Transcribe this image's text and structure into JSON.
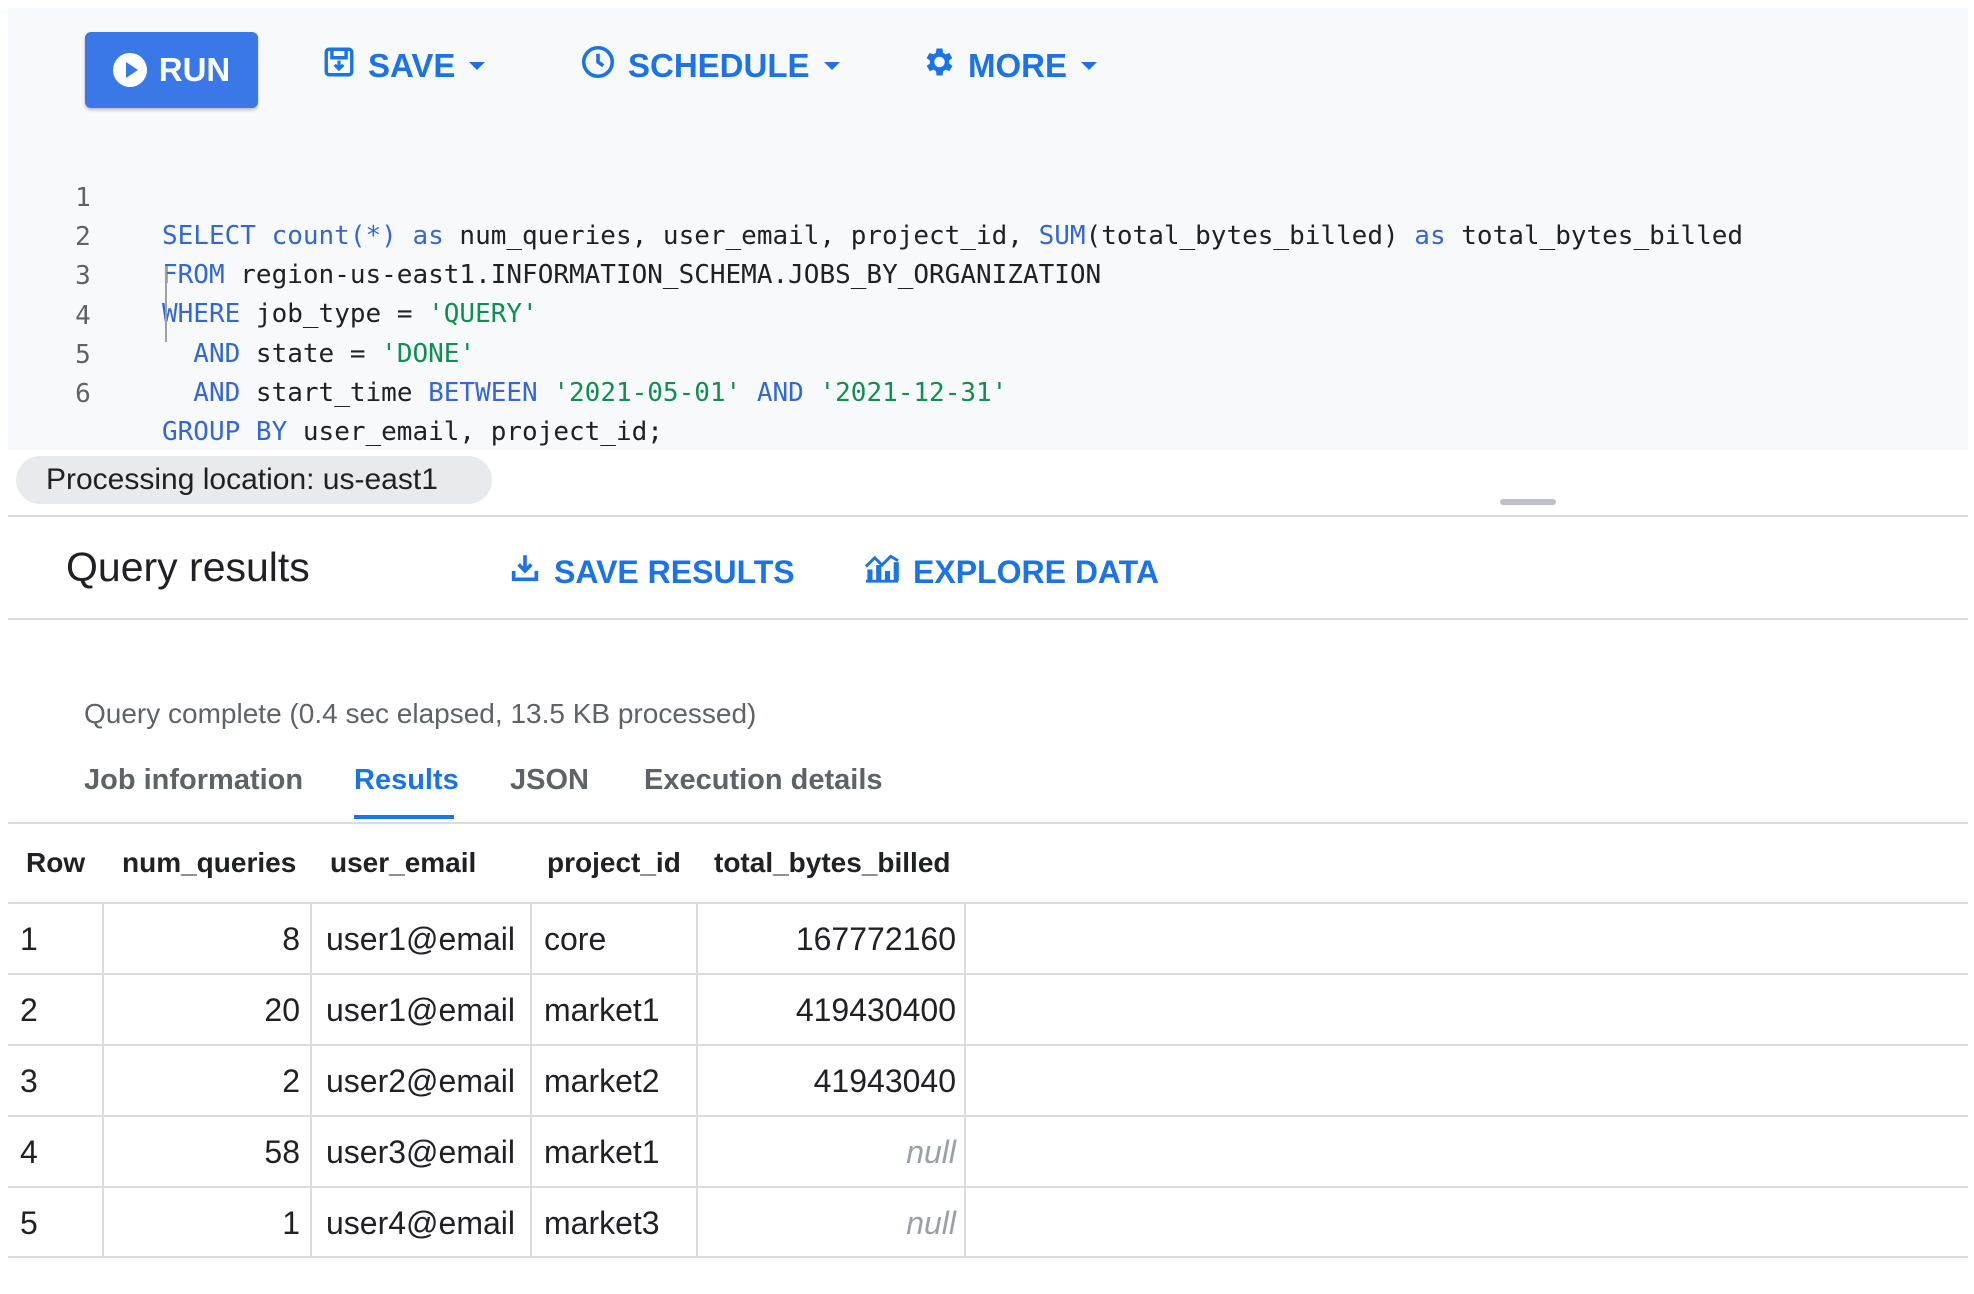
{
  "toolbar": {
    "run_label": "RUN",
    "save_label": "SAVE",
    "schedule_label": "SCHEDULE",
    "more_label": "MORE"
  },
  "editor": {
    "lines": [
      {
        "num": "1"
      },
      {
        "num": "2"
      },
      {
        "num": "3"
      },
      {
        "num": "4"
      },
      {
        "num": "5"
      },
      {
        "num": "6"
      }
    ],
    "tokens": {
      "l1_a": "SELECT count(*) as",
      "l1_b": " num_queries, user_email, project_id,",
      "l1_c": " SUM",
      "l1_d": "(total_bytes_billed)",
      "l1_e": " as",
      "l1_f": " total_bytes_billed",
      "l2_a": "FROM",
      "l2_b": " region-us-east1.INFORMATION_SCHEMA.JOBS_BY_ORGANIZATION",
      "l3_a": "WHERE",
      "l3_b": " job_type = ",
      "l3_c": "'QUERY'",
      "l4_a": "  AND",
      "l4_b": " state = ",
      "l4_c": "'DONE'",
      "l5_a": "  AND",
      "l5_b": " start_time ",
      "l5_c": "BETWEEN",
      "l5_d": " ",
      "l5_e": "'2021-05-01'",
      "l5_f": " AND",
      "l5_g": " ",
      "l5_h": "'2021-12-31'",
      "l6_a": "GROUP BY",
      "l6_b": " user_email, project_id;"
    }
  },
  "processing_location": "Processing location: us-east1",
  "results": {
    "title": "Query results",
    "save_results_label": "SAVE RESULTS",
    "explore_data_label": "EXPLORE DATA",
    "status": "Query complete (0.4 sec elapsed, 13.5 KB processed)",
    "tabs": [
      "Job information",
      "Results",
      "JSON",
      "Execution details"
    ],
    "active_tab": "Results",
    "columns": [
      "Row",
      "num_queries",
      "user_email",
      "project_id",
      "total_bytes_billed"
    ],
    "rows": [
      [
        "1",
        "8",
        "user1@email",
        "core",
        "167772160"
      ],
      [
        "2",
        "20",
        "user1@email",
        "market1",
        "419430400"
      ],
      [
        "3",
        "2",
        "user2@email",
        "market2",
        "41943040"
      ],
      [
        "4",
        "58",
        "user3@email",
        "market1",
        "null"
      ],
      [
        "5",
        "1",
        "user4@email",
        "market3",
        "null"
      ]
    ]
  },
  "colors": {
    "accent": "#1a73e8",
    "run_button": "#3b78e7",
    "keyword": "#3367d6",
    "string": "#0d904f"
  }
}
